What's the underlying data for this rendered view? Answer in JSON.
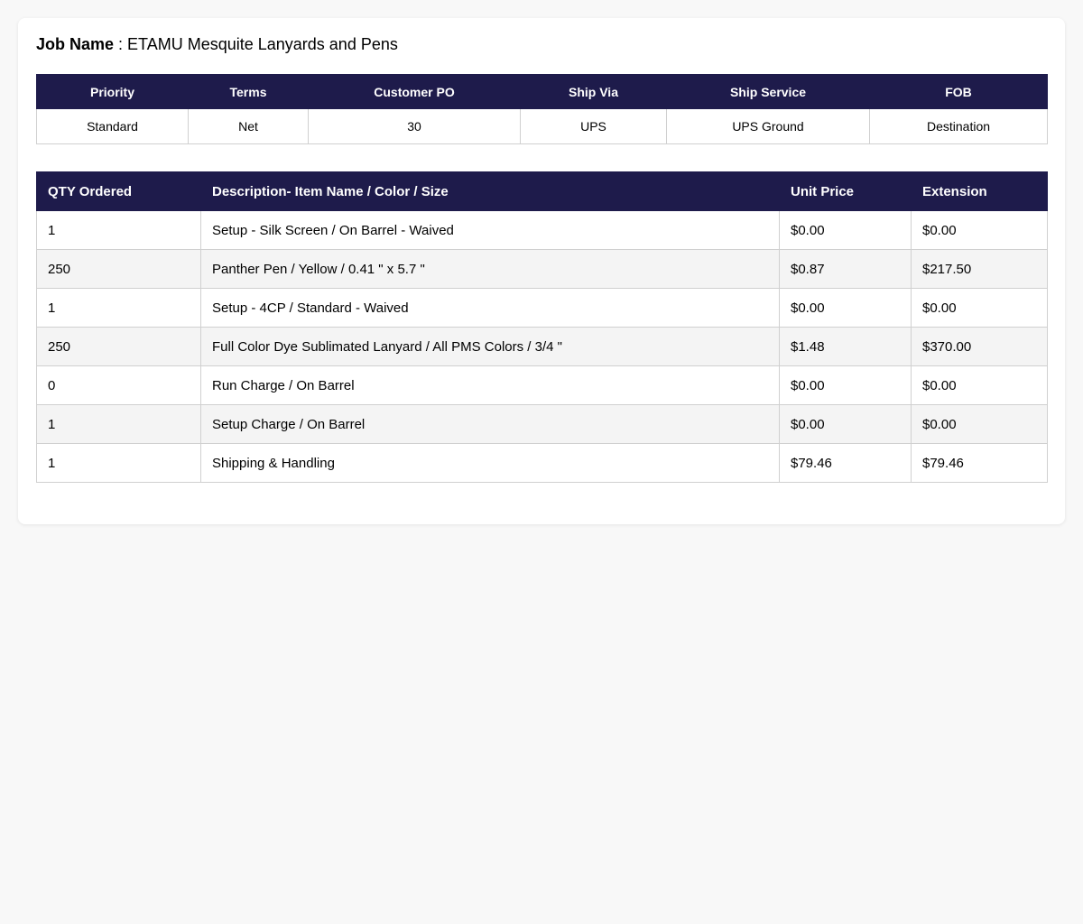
{
  "job": {
    "label": "Job Name",
    "separator": " : ",
    "value": "ETAMU Mesquite Lanyards and Pens"
  },
  "info": {
    "headers": {
      "priority": "Priority",
      "terms": "Terms",
      "customer_po": "Customer PO",
      "ship_via": "Ship Via",
      "ship_service": "Ship Service",
      "fob": "FOB"
    },
    "values": {
      "priority": "Standard",
      "terms": "Net",
      "customer_po": "30",
      "ship_via": "UPS",
      "ship_service": "UPS Ground",
      "fob": "Destination"
    }
  },
  "items": {
    "headers": {
      "qty": "QTY Ordered",
      "description": "Description- Item Name / Color / Size",
      "unit_price": "Unit Price",
      "extension": "Extension"
    },
    "rows": [
      {
        "qty": "1",
        "description": "Setup - Silk Screen / On Barrel - Waived",
        "unit_price": "$0.00",
        "extension": "$0.00"
      },
      {
        "qty": "250",
        "description": "Panther Pen / Yellow / 0.41 \" x 5.7 \"",
        "unit_price": "$0.87",
        "extension": "$217.50"
      },
      {
        "qty": "1",
        "description": "Setup - 4CP / Standard - Waived",
        "unit_price": "$0.00",
        "extension": "$0.00"
      },
      {
        "qty": "250",
        "description": "Full Color Dye Sublimated Lanyard / All PMS Colors / 3/4 \"",
        "unit_price": "$1.48",
        "extension": "$370.00"
      },
      {
        "qty": "0",
        "description": "Run Charge / On Barrel",
        "unit_price": "$0.00",
        "extension": "$0.00"
      },
      {
        "qty": "1",
        "description": "Setup Charge / On Barrel",
        "unit_price": "$0.00",
        "extension": "$0.00"
      },
      {
        "qty": "1",
        "description": "Shipping & Handling",
        "unit_price": "$79.46",
        "extension": "$79.46"
      }
    ]
  },
  "colors": {
    "header_bg": "#1e1b4b",
    "page_bg": "#f8f8f8",
    "stripe_bg": "#f4f4f4"
  }
}
